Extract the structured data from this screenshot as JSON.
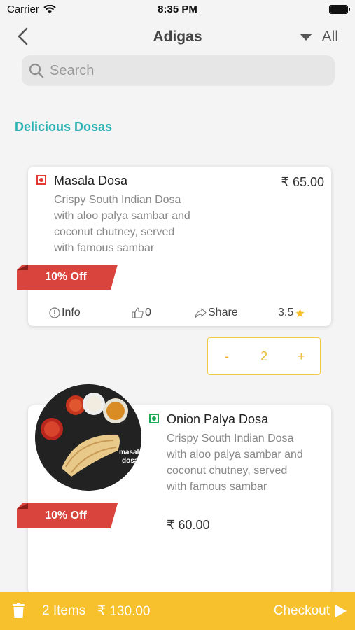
{
  "status_bar": {
    "carrier": "Carrier",
    "time": "8:35 PM"
  },
  "nav": {
    "title": "Adigas",
    "filter_label": "All"
  },
  "search": {
    "placeholder": "Search"
  },
  "section": {
    "title": "Delicious Dosas"
  },
  "items": [
    {
      "name": "Masala Dosa",
      "price": "₹ 65.00",
      "description": [
        "Crispy South Indian Dosa",
        "with aloo palya sambar and",
        "coconut chutney, served",
        "with famous sambar"
      ],
      "offer": "10% Off",
      "info_label": "Info",
      "likes": "0",
      "share_label": "Share",
      "rating": "3.5",
      "veg_color": "#e53935"
    },
    {
      "name": "Onion Palya Dosa",
      "price": "₹ 60.00",
      "description": [
        "Crispy South Indian Dosa",
        "with aloo palya sambar and",
        "coconut chutney, served",
        "with famous sambar"
      ],
      "offer": "10% Off",
      "image_caption": [
        "masala",
        "dosa"
      ],
      "veg_color": "#1faa59"
    }
  ],
  "stepper": {
    "minus": "-",
    "quantity": "2",
    "plus": "+"
  },
  "cart_bar": {
    "items": "2 Items",
    "total": "₹ 130.00",
    "checkout": "Checkout"
  },
  "colors": {
    "accent": "#2bb3b3",
    "brand_yellow": "#f6c12d",
    "offer_red": "#d9443c",
    "rating_star": "#f6c12d"
  }
}
